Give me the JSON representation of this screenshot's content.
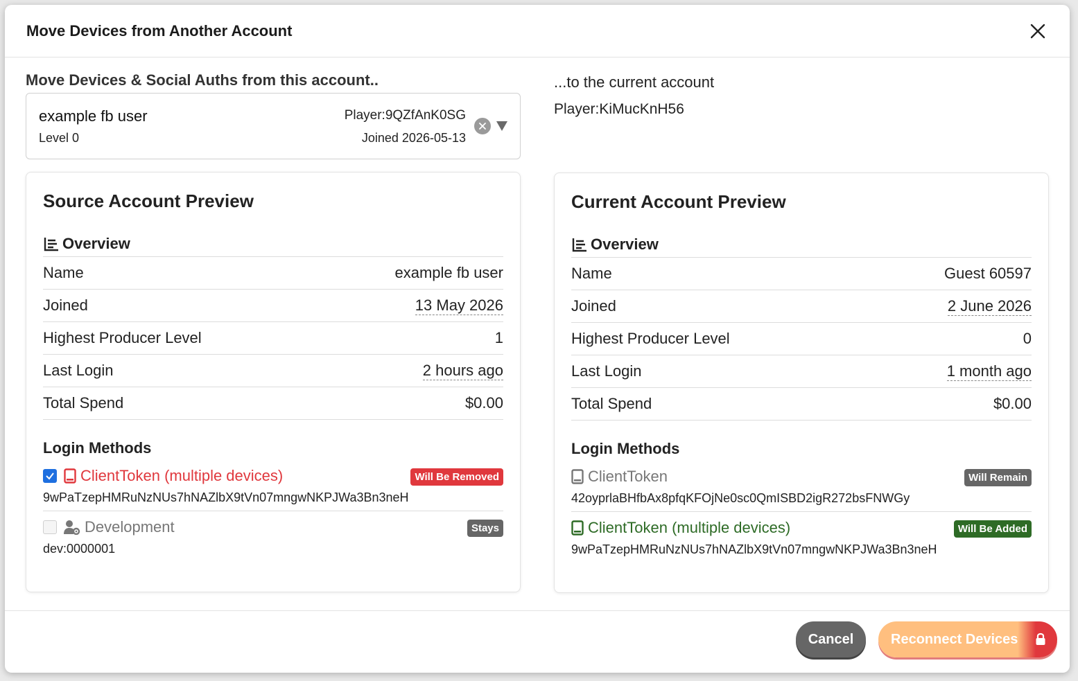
{
  "modal": {
    "title": "Move Devices from Another Account"
  },
  "source_select": {
    "heading": "Move Devices & Social Auths from this account..",
    "name": "example fb user",
    "level": "Level 0",
    "player_id": "Player:9QZfAnK0SG",
    "joined": "Joined 2026-05-13"
  },
  "target": {
    "heading": "...to the current account",
    "player_id": "Player:KiMucKnH56"
  },
  "source_preview": {
    "title": "Source Account Preview",
    "overview_label": "Overview",
    "rows": [
      {
        "label": "Name",
        "value": "example fb user"
      },
      {
        "label": "Joined",
        "value": "13 May 2026"
      },
      {
        "label": "Highest Producer Level",
        "value": "1"
      },
      {
        "label": "Last Login",
        "value": "2 hours ago"
      },
      {
        "label": "Total Spend",
        "value": "$0.00"
      }
    ],
    "login_title": "Login Methods",
    "methods": [
      {
        "label": "ClientToken (multiple devices)",
        "token": "9wPaTzepHMRuNzNUs7hNAZlbX9tVn07mngwNKPJWa3Bn3neH",
        "badge": "Will Be Removed",
        "checked": true
      },
      {
        "label": "Development",
        "token": "dev:0000001",
        "badge": "Stays",
        "checked": false
      }
    ]
  },
  "current_preview": {
    "title": "Current Account Preview",
    "overview_label": "Overview",
    "rows": [
      {
        "label": "Name",
        "value": "Guest 60597"
      },
      {
        "label": "Joined",
        "value": "2 June 2026"
      },
      {
        "label": "Highest Producer Level",
        "value": "0"
      },
      {
        "label": "Last Login",
        "value": "1 month ago"
      },
      {
        "label": "Total Spend",
        "value": "$0.00"
      }
    ],
    "login_title": "Login Methods",
    "methods": [
      {
        "label": "ClientToken",
        "token": "42oyprlaBHfbAx8pfqKFOjNe0sc0QmISBD2igR272bsFNWGy",
        "badge": "Will Remain"
      },
      {
        "label": "ClientToken (multiple devices)",
        "token": "9wPaTzepHMRuNzNUs7hNAZlbX9tVn07mngwNKPJWa3Bn3neH",
        "badge": "Will Be Added"
      }
    ]
  },
  "footer": {
    "cancel_label": "Cancel",
    "reconnect_label": "Reconnect Devices"
  },
  "colors": {
    "removed": "#e0383d",
    "added": "#2e6b26",
    "neutral": "#666666",
    "accent": "#ffbf7f"
  }
}
